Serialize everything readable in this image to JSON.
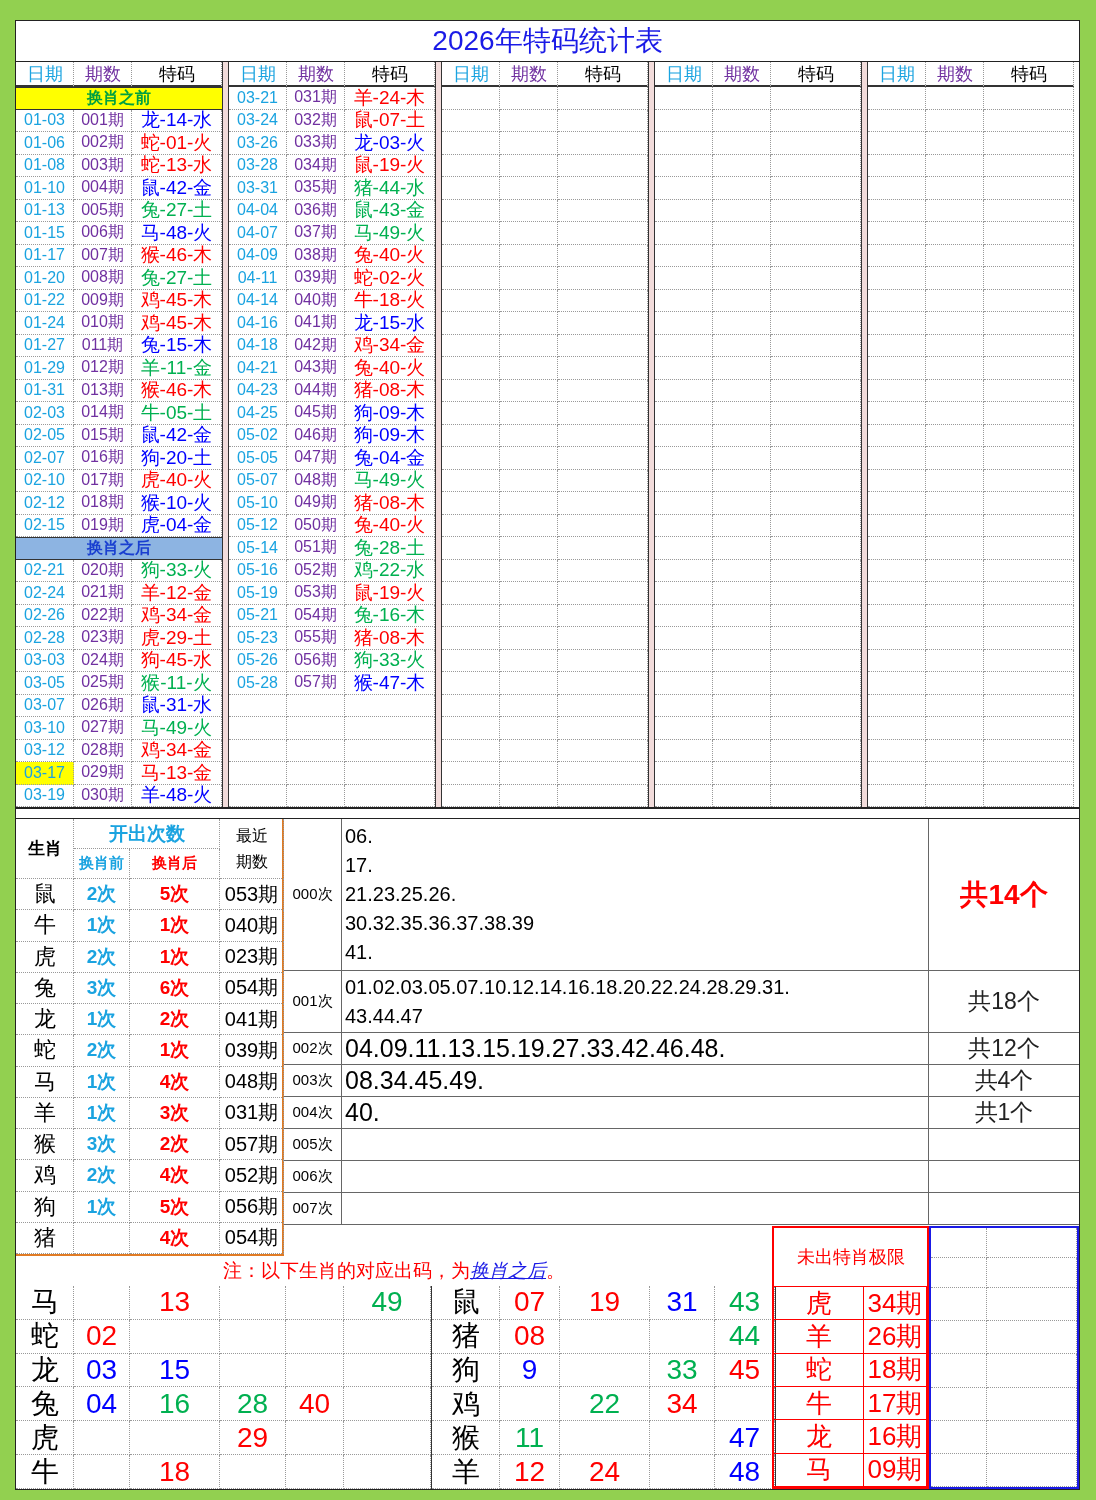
{
  "title": "2026年特码统计表",
  "groups": [
    {
      "headers": [
        "日期",
        "期数",
        "特码"
      ],
      "rows": [
        {
          "kind": "section",
          "label": "换肖之前",
          "color": "#ffff00"
        },
        {
          "kind": "entry",
          "date": "01-03",
          "period": "001期",
          "code": "龙-14-水",
          "color": "#0000ff",
          "highlighted": false
        },
        {
          "kind": "entry",
          "date": "01-06",
          "period": "002期",
          "code": "蛇-01-火",
          "color": "#ff0000",
          "highlighted": false
        },
        {
          "kind": "entry",
          "date": "01-08",
          "period": "003期",
          "code": "蛇-13-水",
          "color": "#ff0000",
          "highlighted": false
        },
        {
          "kind": "entry",
          "date": "01-10",
          "period": "004期",
          "code": "鼠-42-金",
          "color": "#0000ff",
          "highlighted": false
        },
        {
          "kind": "entry",
          "date": "01-13",
          "period": "005期",
          "code": "兔-27-土",
          "color": "#00b050",
          "highlighted": false
        },
        {
          "kind": "entry",
          "date": "01-15",
          "period": "006期",
          "code": "马-48-火",
          "color": "#0000ff",
          "highlighted": false
        },
        {
          "kind": "entry",
          "date": "01-17",
          "period": "007期",
          "code": "猴-46-木",
          "color": "#ff0000",
          "highlighted": false
        },
        {
          "kind": "entry",
          "date": "01-20",
          "period": "008期",
          "code": "兔-27-土",
          "color": "#00b050",
          "highlighted": false
        },
        {
          "kind": "entry",
          "date": "01-22",
          "period": "009期",
          "code": "鸡-45-木",
          "color": "#ff0000",
          "highlighted": false
        },
        {
          "kind": "entry",
          "date": "01-24",
          "period": "010期",
          "code": "鸡-45-木",
          "color": "#ff0000",
          "highlighted": false
        },
        {
          "kind": "entry",
          "date": "01-27",
          "period": "011期",
          "code": "兔-15-木",
          "color": "#0000ff",
          "highlighted": false
        },
        {
          "kind": "entry",
          "date": "01-29",
          "period": "012期",
          "code": "羊-11-金",
          "color": "#00b050",
          "highlighted": false
        },
        {
          "kind": "entry",
          "date": "01-31",
          "period": "013期",
          "code": "猴-46-木",
          "color": "#ff0000",
          "highlighted": false
        },
        {
          "kind": "entry",
          "date": "02-03",
          "period": "014期",
          "code": "牛-05-土",
          "color": "#00b050",
          "highlighted": false
        },
        {
          "kind": "entry",
          "date": "02-05",
          "period": "015期",
          "code": "鼠-42-金",
          "color": "#0000ff",
          "highlighted": false
        },
        {
          "kind": "entry",
          "date": "02-07",
          "period": "016期",
          "code": "狗-20-土",
          "color": "#0000ff",
          "highlighted": false
        },
        {
          "kind": "entry",
          "date": "02-10",
          "period": "017期",
          "code": "虎-40-火",
          "color": "#ff0000",
          "highlighted": false
        },
        {
          "kind": "entry",
          "date": "02-12",
          "period": "018期",
          "code": "猴-10-火",
          "color": "#0000ff",
          "highlighted": false
        },
        {
          "kind": "entry",
          "date": "02-15",
          "period": "019期",
          "code": "虎-04-金",
          "color": "#0000ff",
          "highlighted": false
        },
        {
          "kind": "section",
          "label": "换肖之后",
          "color": "#8db4e2"
        },
        {
          "kind": "entry",
          "date": "02-21",
          "period": "020期",
          "code": "狗-33-火",
          "color": "#00b050",
          "highlighted": false
        },
        {
          "kind": "entry",
          "date": "02-24",
          "period": "021期",
          "code": "羊-12-金",
          "color": "#ff0000",
          "highlighted": false
        },
        {
          "kind": "entry",
          "date": "02-26",
          "period": "022期",
          "code": "鸡-34-金",
          "color": "#ff0000",
          "highlighted": false
        },
        {
          "kind": "entry",
          "date": "02-28",
          "period": "023期",
          "code": "虎-29-土",
          "color": "#ff0000",
          "highlighted": false
        },
        {
          "kind": "entry",
          "date": "03-03",
          "period": "024期",
          "code": "狗-45-水",
          "color": "#ff0000",
          "highlighted": false
        },
        {
          "kind": "entry",
          "date": "03-05",
          "period": "025期",
          "code": "猴-11-火",
          "color": "#00b050",
          "highlighted": false
        },
        {
          "kind": "entry",
          "date": "03-07",
          "period": "026期",
          "code": "鼠-31-水",
          "color": "#0000ff",
          "highlighted": false
        },
        {
          "kind": "entry",
          "date": "03-10",
          "period": "027期",
          "code": "马-49-火",
          "color": "#00b050",
          "highlighted": false
        },
        {
          "kind": "entry",
          "date": "03-12",
          "period": "028期",
          "code": "鸡-34-金",
          "color": "#ff0000",
          "highlighted": false
        },
        {
          "kind": "entry",
          "date": "03-17",
          "period": "029期",
          "code": "马-13-金",
          "color": "#ff0000",
          "highlighted": true
        },
        {
          "kind": "entry",
          "date": "03-19",
          "period": "030期",
          "code": "羊-48-火",
          "color": "#0000ff",
          "highlighted": false
        }
      ]
    },
    {
      "headers": [
        "日期",
        "期数",
        "特码"
      ],
      "rows": [
        {
          "kind": "entry",
          "date": "03-21",
          "period": "031期",
          "code": "羊-24-木",
          "color": "#ff0000",
          "highlighted": false
        },
        {
          "kind": "entry",
          "date": "03-24",
          "period": "032期",
          "code": "鼠-07-土",
          "color": "#ff0000",
          "highlighted": false
        },
        {
          "kind": "entry",
          "date": "03-26",
          "period": "033期",
          "code": "龙-03-火",
          "color": "#0000ff",
          "highlighted": false
        },
        {
          "kind": "entry",
          "date": "03-28",
          "period": "034期",
          "code": "鼠-19-火",
          "color": "#ff0000",
          "highlighted": false
        },
        {
          "kind": "entry",
          "date": "03-31",
          "period": "035期",
          "code": "猪-44-水",
          "color": "#00b050",
          "highlighted": false
        },
        {
          "kind": "entry",
          "date": "04-04",
          "period": "036期",
          "code": "鼠-43-金",
          "color": "#00b050",
          "highlighted": false
        },
        {
          "kind": "entry",
          "date": "04-07",
          "period": "037期",
          "code": "马-49-火",
          "color": "#00b050",
          "highlighted": false
        },
        {
          "kind": "entry",
          "date": "04-09",
          "period": "038期",
          "code": "兔-40-火",
          "color": "#ff0000",
          "highlighted": false
        },
        {
          "kind": "entry",
          "date": "04-11",
          "period": "039期",
          "code": "蛇-02-火",
          "color": "#ff0000",
          "highlighted": false
        },
        {
          "kind": "entry",
          "date": "04-14",
          "period": "040期",
          "code": "牛-18-火",
          "color": "#ff0000",
          "highlighted": false
        },
        {
          "kind": "entry",
          "date": "04-16",
          "period": "041期",
          "code": "龙-15-水",
          "color": "#0000ff",
          "highlighted": false
        },
        {
          "kind": "entry",
          "date": "04-18",
          "period": "042期",
          "code": "鸡-34-金",
          "color": "#ff0000",
          "highlighted": false
        },
        {
          "kind": "entry",
          "date": "04-21",
          "period": "043期",
          "code": "兔-40-火",
          "color": "#ff0000",
          "highlighted": false
        },
        {
          "kind": "entry",
          "date": "04-23",
          "period": "044期",
          "code": "猪-08-木",
          "color": "#ff0000",
          "highlighted": false
        },
        {
          "kind": "entry",
          "date": "04-25",
          "period": "045期",
          "code": "狗-09-木",
          "color": "#0000ff",
          "highlighted": false
        },
        {
          "kind": "entry",
          "date": "05-02",
          "period": "046期",
          "code": "狗-09-木",
          "color": "#0000ff",
          "highlighted": false
        },
        {
          "kind": "entry",
          "date": "05-05",
          "period": "047期",
          "code": "兔-04-金",
          "color": "#0000ff",
          "highlighted": false
        },
        {
          "kind": "entry",
          "date": "05-07",
          "period": "048期",
          "code": "马-49-火",
          "color": "#00b050",
          "highlighted": false
        },
        {
          "kind": "entry",
          "date": "05-10",
          "period": "049期",
          "code": "猪-08-木",
          "color": "#ff0000",
          "highlighted": false
        },
        {
          "kind": "entry",
          "date": "05-12",
          "period": "050期",
          "code": "兔-40-火",
          "color": "#ff0000",
          "highlighted": false
        },
        {
          "kind": "entry",
          "date": "05-14",
          "period": "051期",
          "code": "兔-28-土",
          "color": "#00b050",
          "highlighted": false
        },
        {
          "kind": "entry",
          "date": "05-16",
          "period": "052期",
          "code": "鸡-22-水",
          "color": "#00b050",
          "highlighted": false
        },
        {
          "kind": "entry",
          "date": "05-19",
          "period": "053期",
          "code": "鼠-19-火",
          "color": "#ff0000",
          "highlighted": false
        },
        {
          "kind": "entry",
          "date": "05-21",
          "period": "054期",
          "code": "兔-16-木",
          "color": "#00b050",
          "highlighted": false
        },
        {
          "kind": "entry",
          "date": "05-23",
          "period": "055期",
          "code": "猪-08-木",
          "color": "#ff0000",
          "highlighted": false
        },
        {
          "kind": "entry",
          "date": "05-26",
          "period": "056期",
          "code": "狗-33-火",
          "color": "#00b050",
          "highlighted": false
        },
        {
          "kind": "entry",
          "date": "05-28",
          "period": "057期",
          "code": "猴-47-木",
          "color": "#0000ff",
          "highlighted": false
        }
      ]
    },
    {
      "headers": [
        "日期",
        "期数",
        "特码"
      ]
    },
    {
      "headers": [
        "日期",
        "期数",
        "特码"
      ]
    },
    {
      "headers": [
        "日期",
        "期数",
        "特码"
      ]
    }
  ],
  "stats": {
    "headers": {
      "zodiac": "生肖",
      "count": "开出次数",
      "before": "换肖前",
      "after": "换肖后",
      "latest": "最近期数"
    },
    "rows": [
      {
        "zodiac": "鼠",
        "before": "2次",
        "after": "5次",
        "latest": "053期"
      },
      {
        "zodiac": "牛",
        "before": "1次",
        "after": "1次",
        "latest": "040期"
      },
      {
        "zodiac": "虎",
        "before": "2次",
        "after": "1次",
        "latest": "023期"
      },
      {
        "zodiac": "兔",
        "before": "3次",
        "after": "6次",
        "latest": "054期"
      },
      {
        "zodiac": "龙",
        "before": "1次",
        "after": "2次",
        "latest": "041期"
      },
      {
        "zodiac": "蛇",
        "before": "2次",
        "after": "1次",
        "latest": "039期"
      },
      {
        "zodiac": "马",
        "before": "1次",
        "after": "4次",
        "latest": "048期"
      },
      {
        "zodiac": "羊",
        "before": "1次",
        "after": "3次",
        "latest": "031期"
      },
      {
        "zodiac": "猴",
        "before": "3次",
        "after": "2次",
        "latest": "057期"
      },
      {
        "zodiac": "鸡",
        "before": "2次",
        "after": "4次",
        "latest": "052期"
      },
      {
        "zodiac": "狗",
        "before": "1次",
        "after": "5次",
        "latest": "056期"
      },
      {
        "zodiac": "猪",
        "after": "4次",
        "latest": "054期"
      }
    ]
  },
  "counts": [
    {
      "label": "000次",
      "lines": [
        "06.",
        "17.",
        "21.23.25.26.",
        "30.32.35.36.37.38.39",
        "41."
      ],
      "total": "共14个",
      "highlighted": true
    },
    {
      "label": "001次",
      "lines": [
        "01.02.03.05.07.10.12.14.16.18.20.22.24.28.29.31.",
        "43.44.47"
      ],
      "total": "共18个",
      "highlighted": false
    },
    {
      "label": "002次",
      "lines": [
        "04.09.11.13.15.19.27.33.42.46.48."
      ],
      "total": "共12个",
      "highlighted": false
    },
    {
      "label": "003次",
      "lines": [
        "08.34.45.49."
      ],
      "total": "共4个",
      "highlighted": false
    },
    {
      "label": "004次",
      "lines": [
        "40."
      ],
      "total": "共1个",
      "highlighted": false
    },
    {
      "label": "005次"
    },
    {
      "label": "006次"
    },
    {
      "label": "007次"
    }
  ],
  "note": {
    "text": "注：以下生肖的对应出码，为",
    "link": "换肖之后",
    "end": "。"
  },
  "limit": {
    "title": "未出特肖极限",
    "rows": [
      {
        "zodiac": "虎",
        "periods": "34期"
      },
      {
        "zodiac": "羊",
        "periods": "26期"
      },
      {
        "zodiac": "蛇",
        "periods": "18期"
      },
      {
        "zodiac": "牛",
        "periods": "17期"
      },
      {
        "zodiac": "龙",
        "periods": "16期"
      },
      {
        "zodiac": "马",
        "periods": "09期"
      }
    ]
  },
  "zodiac_grid": {
    "left": [
      {
        "zodiac": "马",
        "cells": [
          null,
          {
            "text": "13",
            "color": "#ff0000"
          },
          null,
          null,
          {
            "text": "49",
            "color": "#00b050"
          }
        ]
      },
      {
        "zodiac": "蛇",
        "cells": [
          {
            "text": "02",
            "color": "#ff0000"
          },
          null,
          null,
          null,
          null
        ]
      },
      {
        "zodiac": "龙",
        "cells": [
          {
            "text": "03",
            "color": "#0000ff"
          },
          {
            "text": "15",
            "color": "#0000ff"
          },
          null,
          null,
          null
        ]
      },
      {
        "zodiac": "兔",
        "cells": [
          {
            "text": "04",
            "color": "#0000ff"
          },
          {
            "text": "16",
            "color": "#00b050"
          },
          {
            "text": "28",
            "color": "#00b050"
          },
          {
            "text": "40",
            "color": "#ff0000"
          },
          null
        ]
      },
      {
        "zodiac": "虎",
        "cells": [
          null,
          null,
          {
            "text": "29",
            "color": "#ff0000"
          },
          null,
          null
        ]
      },
      {
        "zodiac": "牛",
        "cells": [
          null,
          {
            "text": "18",
            "color": "#ff0000"
          },
          null,
          null,
          null
        ]
      }
    ],
    "right": [
      {
        "zodiac": "鼠",
        "cells": [
          {
            "text": "07",
            "color": "#ff0000"
          },
          {
            "text": "19",
            "color": "#ff0000"
          },
          {
            "text": "31",
            "color": "#0000ff"
          },
          {
            "text": "43",
            "color": "#00b050"
          }
        ]
      },
      {
        "zodiac": "猪",
        "cells": [
          {
            "text": "08",
            "color": "#ff0000"
          },
          null,
          null,
          {
            "text": "44",
            "color": "#00b050"
          }
        ]
      },
      {
        "zodiac": "狗",
        "cells": [
          {
            "text": "9",
            "color": "#0000ff"
          },
          null,
          {
            "text": "33",
            "color": "#00b050"
          },
          {
            "text": "45",
            "color": "#ff0000"
          }
        ]
      },
      {
        "zodiac": "鸡",
        "cells": [
          null,
          {
            "text": "22",
            "color": "#00b050"
          },
          {
            "text": "34",
            "color": "#ff0000"
          },
          null
        ]
      },
      {
        "zodiac": "猴",
        "cells": [
          {
            "text": "11",
            "color": "#00b050"
          },
          null,
          null,
          {
            "text": "47",
            "color": "#0000ff"
          }
        ]
      },
      {
        "zodiac": "羊",
        "cells": [
          {
            "text": "12",
            "color": "#ff0000"
          },
          {
            "text": "24",
            "color": "#ff0000"
          },
          null,
          {
            "text": "48",
            "color": "#0000ff"
          }
        ]
      }
    ]
  }
}
